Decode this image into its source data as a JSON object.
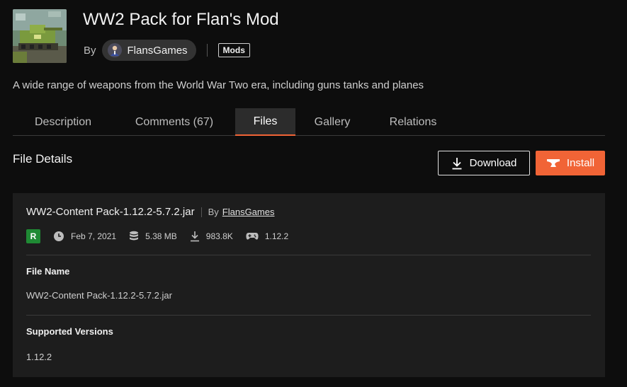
{
  "project": {
    "title": "WW2 Pack for Flan's Mod",
    "by_label": "By",
    "author": "FlansGames",
    "category": "Mods",
    "summary": "A wide range of weapons from the World War Two era, including guns tanks and planes"
  },
  "tabs": [
    {
      "label": "Description",
      "active": false
    },
    {
      "label": "Comments (67)",
      "active": false
    },
    {
      "label": "Files",
      "active": true
    },
    {
      "label": "Gallery",
      "active": false
    },
    {
      "label": "Relations",
      "active": false
    }
  ],
  "file_details": {
    "heading": "File Details",
    "download_label": "Download",
    "install_label": "Install",
    "file_title": "WW2-Content Pack-1.12.2-5.7.2.jar",
    "by_label": "By",
    "author": "FlansGames",
    "release_type": "R",
    "date": "Feb 7, 2021",
    "size": "5.38 MB",
    "downloads": "983.8K",
    "game_version": "1.12.2",
    "file_name_label": "File Name",
    "file_name_value": "WW2-Content Pack-1.12.2-5.7.2.jar",
    "supported_versions_label": "Supported Versions",
    "supported_versions_value": "1.12.2"
  },
  "colors": {
    "accent": "#f16436",
    "release_green": "#1f8a34",
    "background": "#0d0d0d",
    "card": "#1d1d1d"
  },
  "icons": {
    "date": "clock-icon",
    "size": "database-icon",
    "downloads": "download-icon",
    "version": "gamepad-icon",
    "install": "anvil-icon"
  }
}
